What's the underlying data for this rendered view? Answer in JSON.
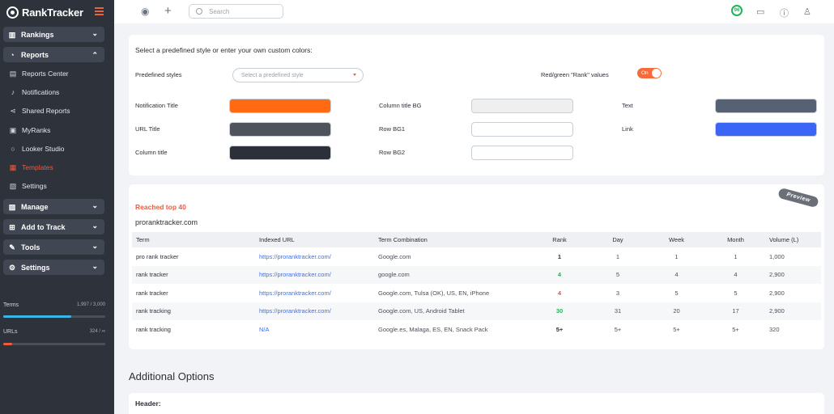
{
  "app": {
    "name": "RankTracker"
  },
  "sidebar": {
    "groups": {
      "rankings": "Rankings",
      "reports": "Reports",
      "manage": "Manage",
      "add_to_track": "Add to Track",
      "tools": "Tools",
      "settings": "Settings"
    },
    "report_items": [
      {
        "label": "Reports Center",
        "icon": "reports-center-icon"
      },
      {
        "label": "Notifications",
        "icon": "bell-icon"
      },
      {
        "label": "Shared Reports",
        "icon": "share-icon"
      },
      {
        "label": "MyRanks",
        "icon": "myranks-icon"
      },
      {
        "label": "Looker Studio",
        "icon": "looker-icon"
      },
      {
        "label": "Templates",
        "icon": "templates-icon",
        "active": true
      },
      {
        "label": "Settings",
        "icon": "settings-doc-icon"
      }
    ],
    "meters": {
      "terms": {
        "label": "Terms",
        "value": "1,997 / 3,000",
        "fraction": 0.666,
        "color": "#3bb4e8"
      },
      "urls": {
        "label": "URLs",
        "value": "324 / ∞",
        "fraction": 0.09,
        "color": "#f25a3c"
      }
    }
  },
  "topbar": {
    "search_placeholder": "Search",
    "score": "96"
  },
  "colors_card": {
    "title": "Select a predefined style or enter your own custom colors:",
    "predefined_label": "Predefined styles",
    "select_placeholder": "Select a predefined style",
    "redgreen_label": "Red/green \"Rank\" values",
    "toggle_label": "On",
    "fields": {
      "notification_title": {
        "label": "Notification Title",
        "color": "#ff6a13"
      },
      "url_title": {
        "label": "URL Title",
        "color": "#4f545c"
      },
      "column_title": {
        "label": "Column title",
        "color": "#2c3039"
      },
      "column_title_bg": {
        "label": "Column title BG",
        "color": "#efeff0"
      },
      "row_bg1": {
        "label": "Row BG1",
        "color": "#ffffff"
      },
      "row_bg2": {
        "label": "Row BG2",
        "color": "#ffffff"
      },
      "text": {
        "label": "Text",
        "color": "#566173"
      },
      "link": {
        "label": "Link",
        "color": "#3b66f5"
      }
    }
  },
  "preview_card": {
    "badge": "Preview",
    "title": "Reached top 40",
    "domain": "proranktracker.com",
    "headers": [
      "Term",
      "Indexed URL",
      "Term Combination",
      "Rank",
      "Day",
      "Week",
      "Month",
      "Volume (L)"
    ],
    "rows": [
      {
        "term": "pro rank tracker",
        "url": "https://proranktracker.com/",
        "combo": "Google.com",
        "rank": "1",
        "rank_color": "dark",
        "day": "1",
        "week": "1",
        "month": "1",
        "volume": "1,000"
      },
      {
        "term": "rank tracker",
        "url": "https://proranktracker.com/",
        "combo": "google.com",
        "rank": "4",
        "rank_color": "green",
        "day": "5",
        "week": "4",
        "month": "4",
        "volume": "2,900"
      },
      {
        "term": "rank tracker",
        "url": "https://proranktracker.com/",
        "combo": "Google.com, Tulsa (OK), US, EN, iPhone",
        "rank": "4",
        "rank_color": "red",
        "day": "3",
        "week": "5",
        "month": "5",
        "volume": "2,900"
      },
      {
        "term": "rank tracking",
        "url": "https://proranktracker.com/",
        "combo": "Google.com, US, Android Tablet",
        "rank": "30",
        "rank_color": "green",
        "day": "31",
        "week": "20",
        "month": "17",
        "volume": "2,900"
      },
      {
        "term": "rank tracking",
        "url": "N/A",
        "combo": "Google.es, Malaga, ES, EN, Snack Pack",
        "rank": "5+",
        "rank_color": "dark",
        "day": "5+",
        "week": "5+",
        "month": "5+",
        "volume": "320"
      }
    ]
  },
  "additional": {
    "title": "Additional Options",
    "header_label": "Header:"
  }
}
